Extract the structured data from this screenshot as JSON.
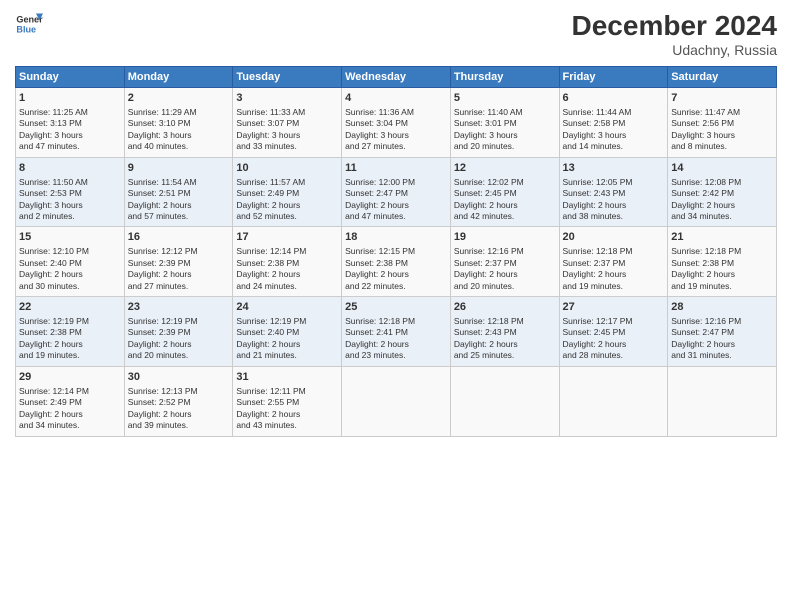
{
  "header": {
    "title": "December 2024",
    "location": "Udachny, Russia",
    "logo_line1": "General",
    "logo_line2": "Blue"
  },
  "days_of_week": [
    "Sunday",
    "Monday",
    "Tuesday",
    "Wednesday",
    "Thursday",
    "Friday",
    "Saturday"
  ],
  "weeks": [
    [
      {
        "day": "1",
        "info": "Sunrise: 11:25 AM\nSunset: 3:13 PM\nDaylight: 3 hours\nand 47 minutes."
      },
      {
        "day": "2",
        "info": "Sunrise: 11:29 AM\nSunset: 3:10 PM\nDaylight: 3 hours\nand 40 minutes."
      },
      {
        "day": "3",
        "info": "Sunrise: 11:33 AM\nSunset: 3:07 PM\nDaylight: 3 hours\nand 33 minutes."
      },
      {
        "day": "4",
        "info": "Sunrise: 11:36 AM\nSunset: 3:04 PM\nDaylight: 3 hours\nand 27 minutes."
      },
      {
        "day": "5",
        "info": "Sunrise: 11:40 AM\nSunset: 3:01 PM\nDaylight: 3 hours\nand 20 minutes."
      },
      {
        "day": "6",
        "info": "Sunrise: 11:44 AM\nSunset: 2:58 PM\nDaylight: 3 hours\nand 14 minutes."
      },
      {
        "day": "7",
        "info": "Sunrise: 11:47 AM\nSunset: 2:56 PM\nDaylight: 3 hours\nand 8 minutes."
      }
    ],
    [
      {
        "day": "8",
        "info": "Sunrise: 11:50 AM\nSunset: 2:53 PM\nDaylight: 3 hours\nand 2 minutes."
      },
      {
        "day": "9",
        "info": "Sunrise: 11:54 AM\nSunset: 2:51 PM\nDaylight: 2 hours\nand 57 minutes."
      },
      {
        "day": "10",
        "info": "Sunrise: 11:57 AM\nSunset: 2:49 PM\nDaylight: 2 hours\nand 52 minutes."
      },
      {
        "day": "11",
        "info": "Sunrise: 12:00 PM\nSunset: 2:47 PM\nDaylight: 2 hours\nand 47 minutes."
      },
      {
        "day": "12",
        "info": "Sunrise: 12:02 PM\nSunset: 2:45 PM\nDaylight: 2 hours\nand 42 minutes."
      },
      {
        "day": "13",
        "info": "Sunrise: 12:05 PM\nSunset: 2:43 PM\nDaylight: 2 hours\nand 38 minutes."
      },
      {
        "day": "14",
        "info": "Sunrise: 12:08 PM\nSunset: 2:42 PM\nDaylight: 2 hours\nand 34 minutes."
      }
    ],
    [
      {
        "day": "15",
        "info": "Sunrise: 12:10 PM\nSunset: 2:40 PM\nDaylight: 2 hours\nand 30 minutes."
      },
      {
        "day": "16",
        "info": "Sunrise: 12:12 PM\nSunset: 2:39 PM\nDaylight: 2 hours\nand 27 minutes."
      },
      {
        "day": "17",
        "info": "Sunrise: 12:14 PM\nSunset: 2:38 PM\nDaylight: 2 hours\nand 24 minutes."
      },
      {
        "day": "18",
        "info": "Sunrise: 12:15 PM\nSunset: 2:38 PM\nDaylight: 2 hours\nand 22 minutes."
      },
      {
        "day": "19",
        "info": "Sunrise: 12:16 PM\nSunset: 2:37 PM\nDaylight: 2 hours\nand 20 minutes."
      },
      {
        "day": "20",
        "info": "Sunrise: 12:18 PM\nSunset: 2:37 PM\nDaylight: 2 hours\nand 19 minutes."
      },
      {
        "day": "21",
        "info": "Sunrise: 12:18 PM\nSunset: 2:38 PM\nDaylight: 2 hours\nand 19 minutes."
      }
    ],
    [
      {
        "day": "22",
        "info": "Sunrise: 12:19 PM\nSunset: 2:38 PM\nDaylight: 2 hours\nand 19 minutes."
      },
      {
        "day": "23",
        "info": "Sunrise: 12:19 PM\nSunset: 2:39 PM\nDaylight: 2 hours\nand 20 minutes."
      },
      {
        "day": "24",
        "info": "Sunrise: 12:19 PM\nSunset: 2:40 PM\nDaylight: 2 hours\nand 21 minutes."
      },
      {
        "day": "25",
        "info": "Sunrise: 12:18 PM\nSunset: 2:41 PM\nDaylight: 2 hours\nand 23 minutes."
      },
      {
        "day": "26",
        "info": "Sunrise: 12:18 PM\nSunset: 2:43 PM\nDaylight: 2 hours\nand 25 minutes."
      },
      {
        "day": "27",
        "info": "Sunrise: 12:17 PM\nSunset: 2:45 PM\nDaylight: 2 hours\nand 28 minutes."
      },
      {
        "day": "28",
        "info": "Sunrise: 12:16 PM\nSunset: 2:47 PM\nDaylight: 2 hours\nand 31 minutes."
      }
    ],
    [
      {
        "day": "29",
        "info": "Sunrise: 12:14 PM\nSunset: 2:49 PM\nDaylight: 2 hours\nand 34 minutes."
      },
      {
        "day": "30",
        "info": "Sunrise: 12:13 PM\nSunset: 2:52 PM\nDaylight: 2 hours\nand 39 minutes."
      },
      {
        "day": "31",
        "info": "Sunrise: 12:11 PM\nSunset: 2:55 PM\nDaylight: 2 hours\nand 43 minutes."
      },
      {
        "day": "",
        "info": ""
      },
      {
        "day": "",
        "info": ""
      },
      {
        "day": "",
        "info": ""
      },
      {
        "day": "",
        "info": ""
      }
    ]
  ]
}
